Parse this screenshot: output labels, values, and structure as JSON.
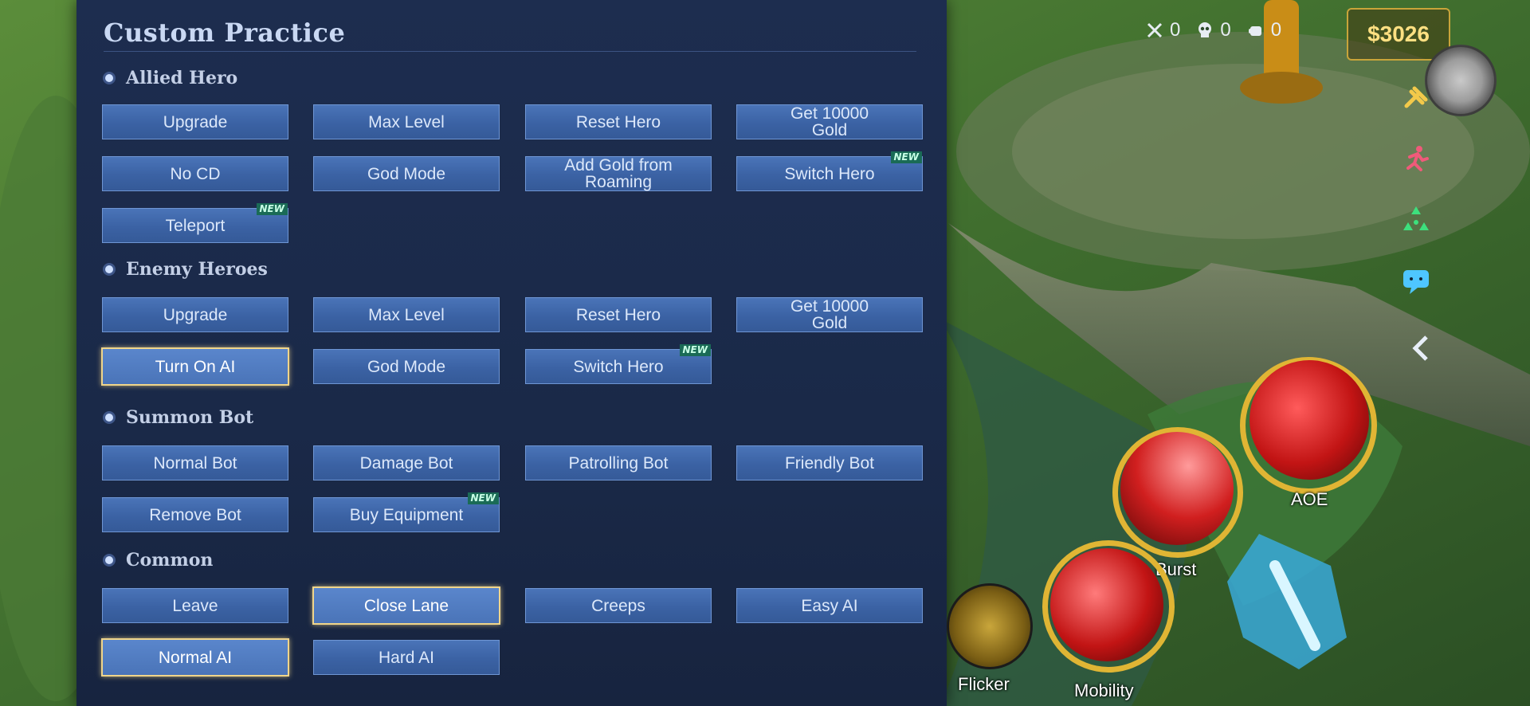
{
  "panel": {
    "title": "Custom Practice",
    "sections": {
      "allied": {
        "label": "Allied Hero"
      },
      "enemy": {
        "label": "Enemy Heroes"
      },
      "summon": {
        "label": "Summon Bot"
      },
      "common": {
        "label": "Common"
      }
    },
    "allied": {
      "upgrade": "Upgrade",
      "max_level": "Max Level",
      "reset_hero": "Reset Hero",
      "get_gold_1": "Get 10000",
      "get_gold_2": "Gold",
      "no_cd": "No CD",
      "god_mode": "God Mode",
      "add_gold_1": "Add Gold from",
      "add_gold_2": "Roaming",
      "switch_hero": "Switch Hero",
      "teleport": "Teleport"
    },
    "enemy": {
      "upgrade": "Upgrade",
      "max_level": "Max Level",
      "reset_hero": "Reset Hero",
      "get_gold_1": "Get 10000",
      "get_gold_2": "Gold",
      "turn_on_ai": "Turn On AI",
      "god_mode": "God Mode",
      "switch_hero": "Switch Hero"
    },
    "summon": {
      "normal_bot": "Normal Bot",
      "damage_bot": "Damage Bot",
      "patrolling_bot": "Patrolling Bot",
      "friendly_bot": "Friendly Bot",
      "remove_bot": "Remove Bot",
      "buy_equipment": "Buy Equipment"
    },
    "common": {
      "leave": "Leave",
      "close_lane": "Close Lane",
      "creeps": "Creeps",
      "easy_ai": "Easy AI",
      "normal_ai": "Normal AI",
      "hard_ai": "Hard AI"
    },
    "new_badge": "NEW"
  },
  "hud": {
    "kills": "0",
    "deaths": "0",
    "assists": "0",
    "gold": "$3026",
    "skills": {
      "aoe": "AOE",
      "burst": "Burst",
      "flicker": "Flicker",
      "mobility": "Mobility"
    }
  },
  "colors": {
    "panel_bg": "#1d2d4f",
    "button_bg": "#3b62a4",
    "selected_border": "#f0d58a",
    "new_badge": "#1a6b56",
    "gold": "#ffe082"
  },
  "icons": {
    "kills": "crossed-swords-icon",
    "deaths": "skull-icon",
    "assists": "fist-icon",
    "rail": [
      "hammer-icon",
      "running-figure-icon",
      "target-arrows-icon",
      "chat-bubble-icon",
      "chevron-left-icon"
    ]
  }
}
